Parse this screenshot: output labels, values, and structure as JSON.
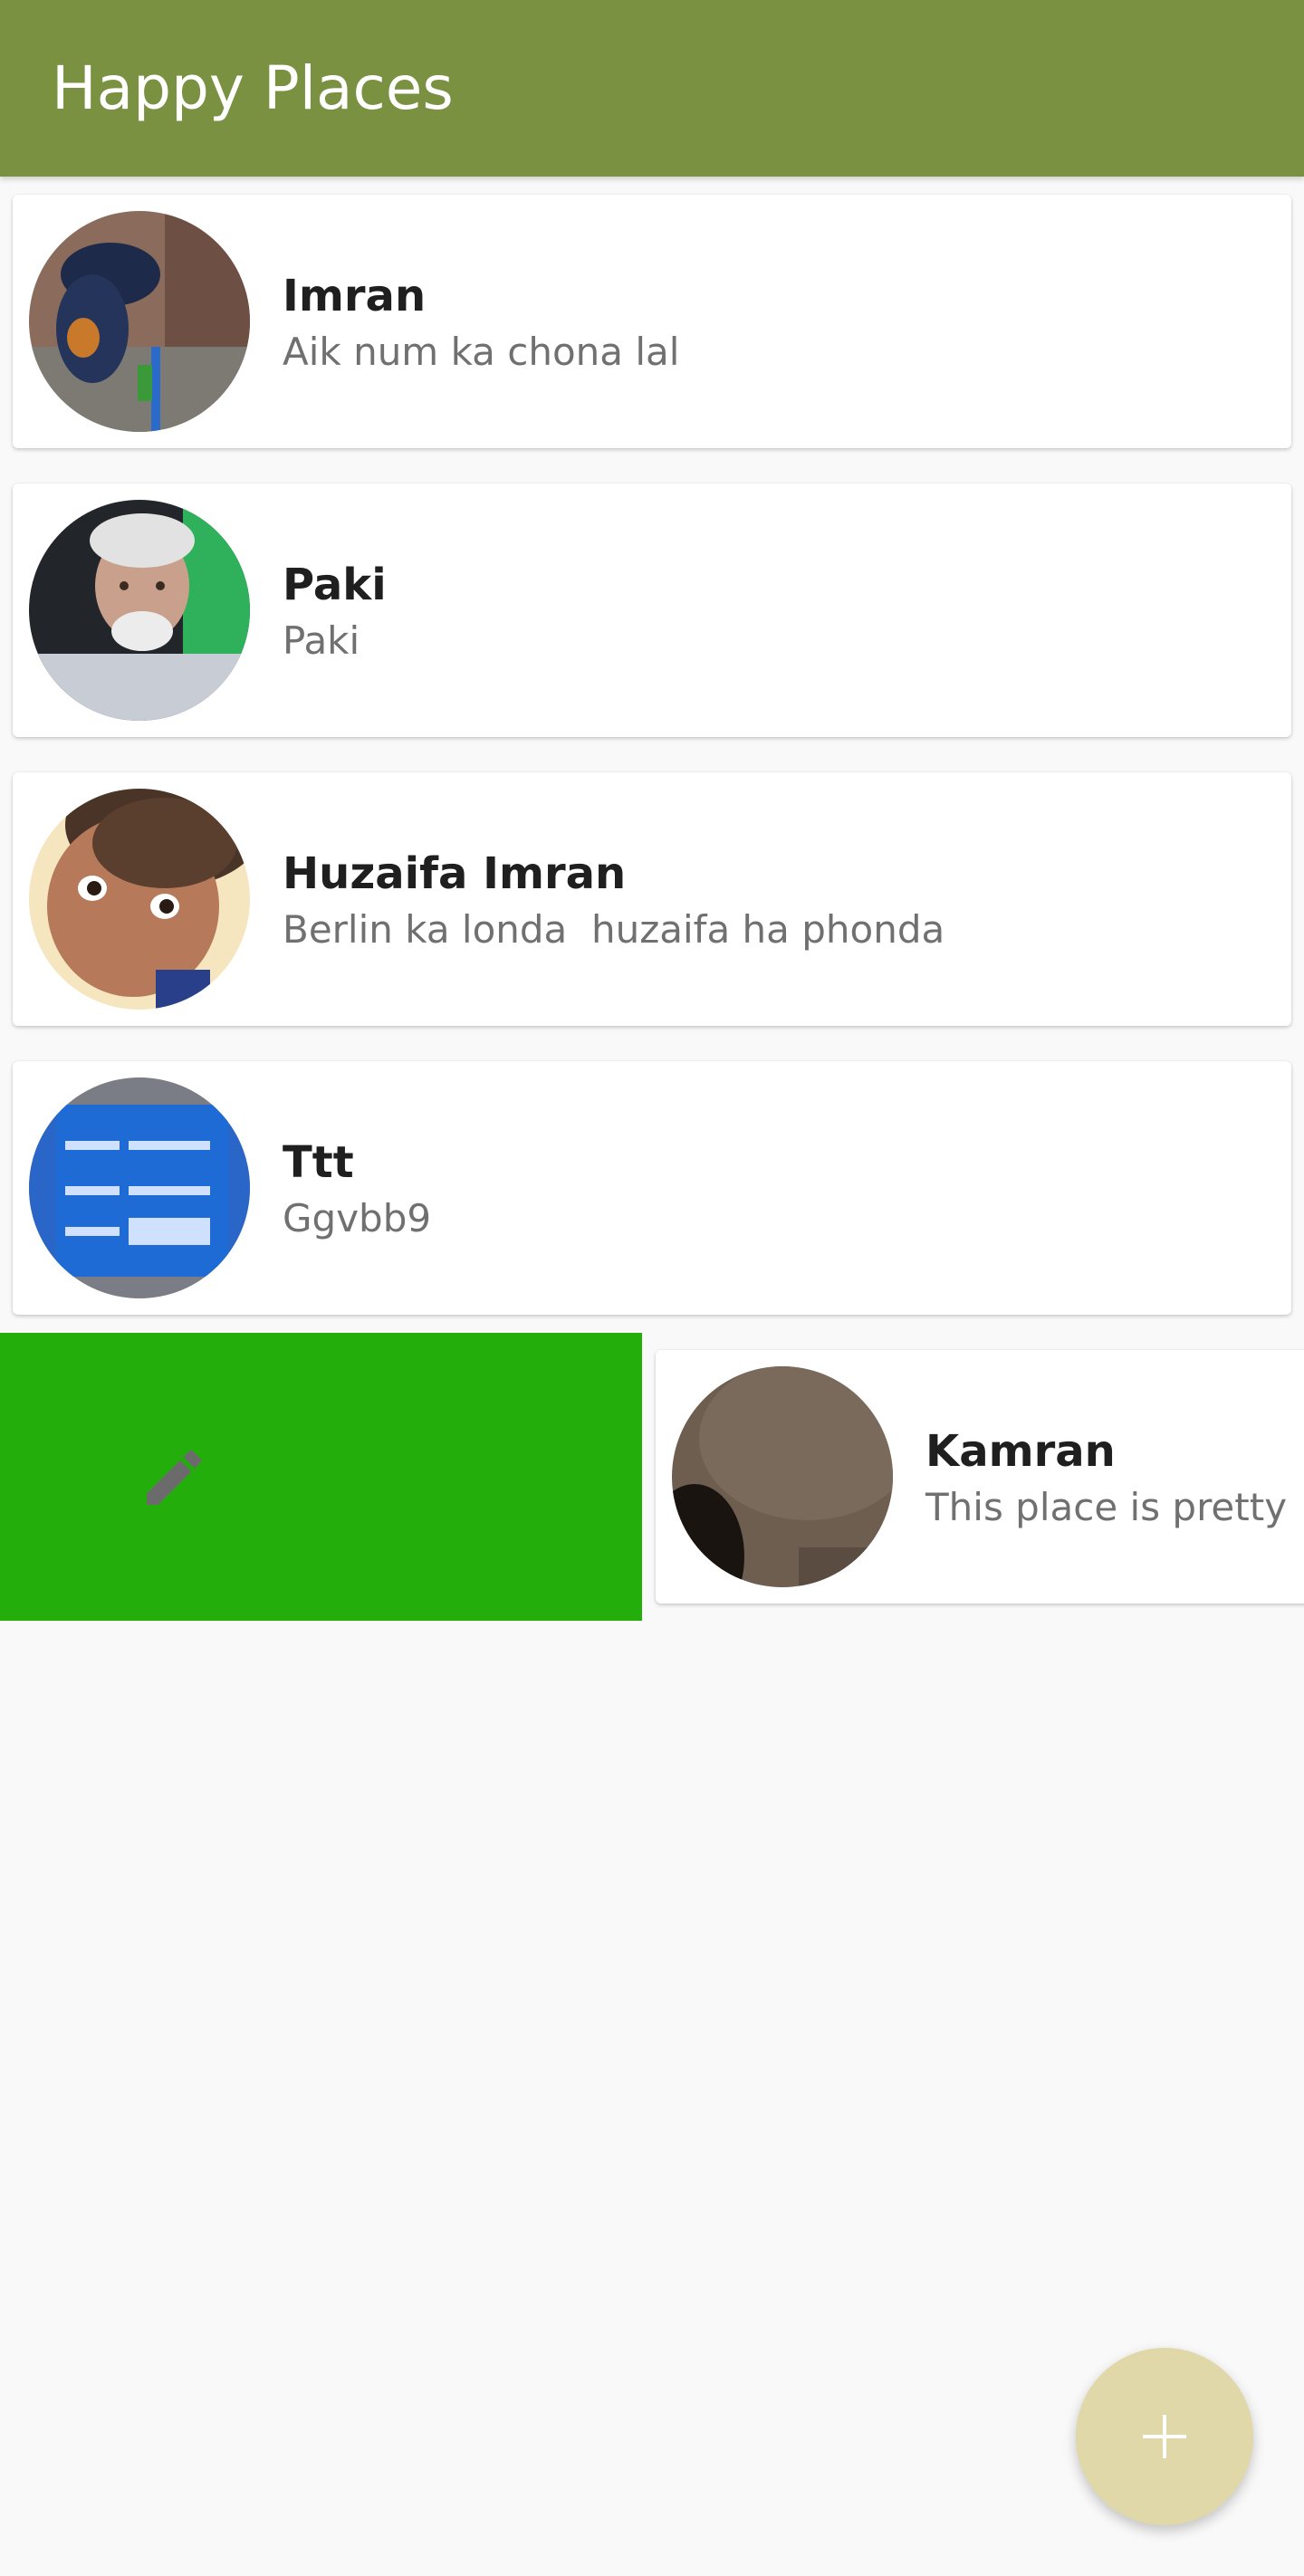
{
  "app": {
    "title": "Happy Places"
  },
  "places": [
    {
      "title": "Imran",
      "description": "Aik num ka chona lal"
    },
    {
      "title": "Paki",
      "description": "Paki"
    },
    {
      "title": "Huzaifa Imran",
      "description": "Berlin ka londa  huzaifa ha phonda"
    },
    {
      "title": "Ttt",
      "description": "Ggvbb9"
    },
    {
      "title": "Kamran",
      "description": "This place is pretty"
    }
  ],
  "swipe_action": {
    "icon": "edit-icon",
    "color": "#24ae0b"
  },
  "fab": {
    "icon": "add-icon",
    "color": "#e0d8a8"
  },
  "colors": {
    "appbar": "#7a9141",
    "background": "#f9f9f9"
  }
}
